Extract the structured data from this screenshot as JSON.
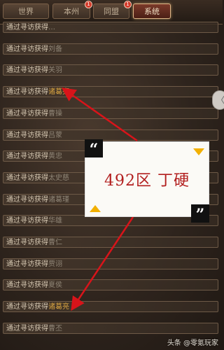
{
  "tabs": [
    {
      "label": "世界",
      "badge": ""
    },
    {
      "label": "本州",
      "badge": "1"
    },
    {
      "label": "同盟",
      "badge": "1"
    },
    {
      "label": "系统",
      "badge": ""
    }
  ],
  "active_tab": "系统",
  "messages": [
    {
      "prefix": "通过寻访获得",
      "name": "…",
      "highlight": false
    },
    {
      "prefix": "通过寻访获得",
      "name": "刘备",
      "highlight": false
    },
    {
      "prefix": "通过寻访获得",
      "name": "关羽",
      "highlight": false
    },
    {
      "prefix": "通过寻访获得",
      "name": "诸葛亮",
      "highlight": true
    },
    {
      "prefix": "通过寻访获得",
      "name": "曹操",
      "highlight": false
    },
    {
      "prefix": "通过寻访获得",
      "name": "吕蒙",
      "highlight": false
    },
    {
      "prefix": "通过寻访获得",
      "name": "黄忠",
      "highlight": false
    },
    {
      "prefix": "通过寻访获得",
      "name": "太史慈",
      "highlight": false
    },
    {
      "prefix": "通过寻访获得",
      "name": "诸葛瑾",
      "highlight": false
    },
    {
      "prefix": "通过寻访获得",
      "name": "华雄",
      "highlight": false
    },
    {
      "prefix": "通过寻访获得",
      "name": "曹仁",
      "highlight": false
    },
    {
      "prefix": "通过寻访获得",
      "name": "贾诩",
      "highlight": false
    },
    {
      "prefix": "通过寻访获得",
      "name": "夏侯",
      "highlight": false
    },
    {
      "prefix": "通过寻访获得",
      "name": "诸葛亮",
      "highlight": true
    },
    {
      "prefix": "通过寻访获得",
      "name": "曹丕",
      "highlight": false
    }
  ],
  "side_button_glyph": "〈",
  "overlay": {
    "open_quote": "“",
    "close_quote": "”",
    "text": "492区  丁硬"
  },
  "watermark": "头条 @零氪玩家",
  "colors": {
    "arrow": "#d8141a",
    "triangle": "#f2b000",
    "name_highlight": "#d9a441",
    "active_tab_border": "#e0b889"
  }
}
